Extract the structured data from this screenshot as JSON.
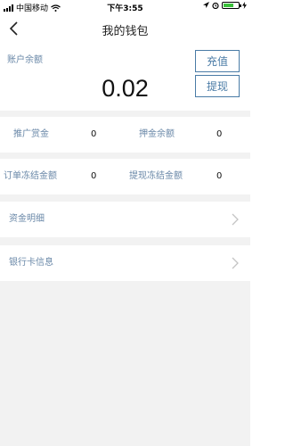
{
  "status_bar": {
    "carrier": "中国移动",
    "time": "下午3:55"
  },
  "nav": {
    "title": "我的钱包"
  },
  "balance": {
    "label": "账户余额",
    "value": "0.02",
    "recharge_label": "充值",
    "withdraw_label": "提现"
  },
  "stats": [
    [
      {
        "label": "推广赏金",
        "value": "0"
      },
      {
        "label": "押金余额",
        "value": "0"
      }
    ],
    [
      {
        "label": "订单冻结金额",
        "value": "0"
      },
      {
        "label": "提现冻结金额",
        "value": "0"
      }
    ]
  ],
  "menu": [
    {
      "label": "资金明细"
    },
    {
      "label": "银行卡信息"
    }
  ],
  "colors": {
    "accent": "#4a7ba6",
    "label": "#6a88a8",
    "background": "#f2f2f2"
  },
  "icons": [
    "signal-icon",
    "wifi-icon",
    "location-icon",
    "alarm-icon",
    "battery-icon",
    "charging-icon",
    "back-icon",
    "chevron-right-icon"
  ]
}
